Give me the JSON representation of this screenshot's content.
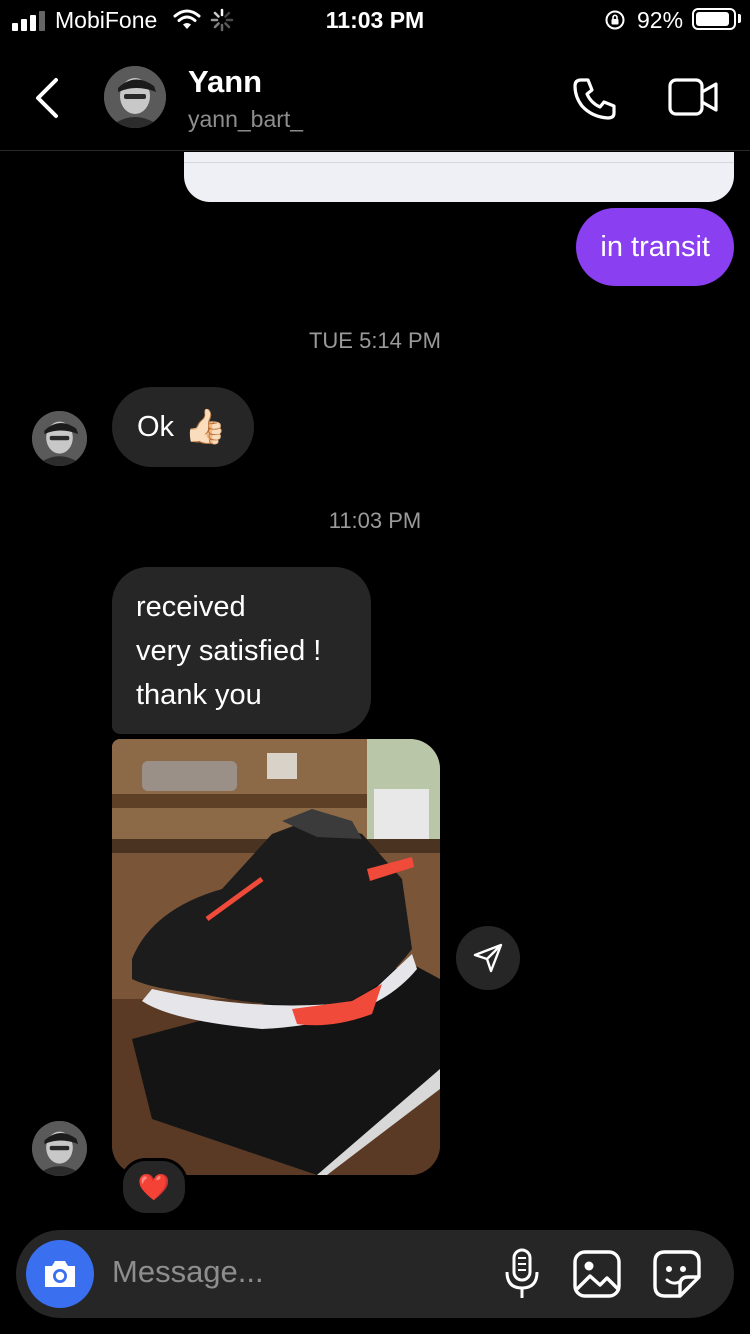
{
  "status_bar": {
    "carrier": "MobiFone",
    "time": "11:03 PM",
    "battery_percent": "92%",
    "battery_level": 0.92,
    "signal_bars": 3
  },
  "header": {
    "name": "Yann",
    "handle": "yann_bart_",
    "icons": [
      "back-chevron-icon",
      "phone-icon",
      "video-camera-icon"
    ]
  },
  "messages": {
    "outgoing_1": "in transit",
    "timestamp_1": "TUE 5:14 PM",
    "incoming_ok": "Ok",
    "incoming_ok_emoji": "👍🏻",
    "timestamp_2": "11:03 PM",
    "incoming_received": [
      "received",
      "very satisfied !",
      "thank you"
    ],
    "reaction_emoji": "❤️"
  },
  "composer": {
    "placeholder": "Message..."
  },
  "colors": {
    "background": "#000000",
    "outgoing_bubble": "#8a3ff0",
    "incoming_bubble": "#262626",
    "camera_button": "#3a6ff0",
    "muted_text": "#8e8e8e"
  }
}
